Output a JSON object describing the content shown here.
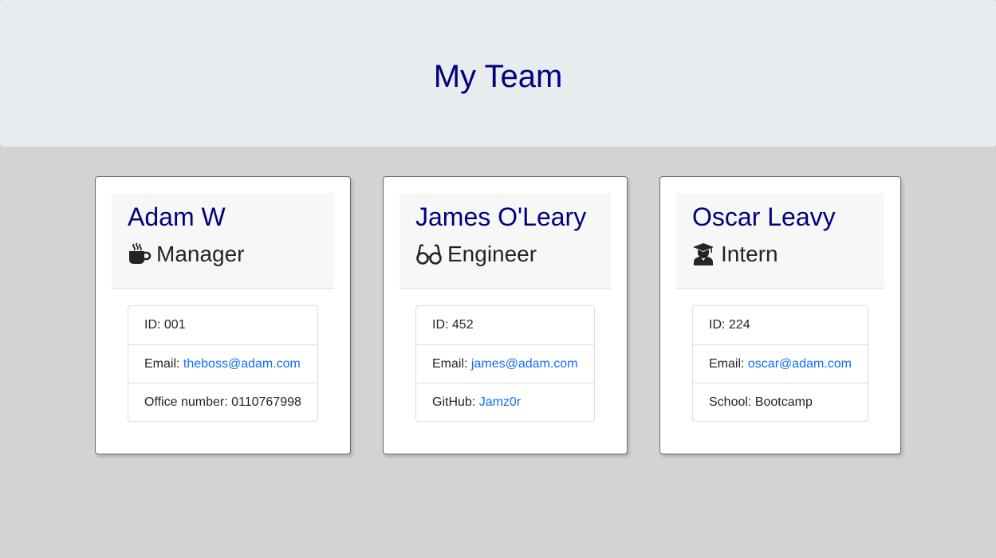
{
  "header": {
    "title": "My Team"
  },
  "colors": {
    "title": "#00007d",
    "link": "#0d6efd",
    "background": "#d3d3d3"
  },
  "members": [
    {
      "name": "Adam W",
      "role": "Manager",
      "role_icon": "coffee-icon",
      "id_label": "ID:",
      "id": "001",
      "email_label": "Email:",
      "email": "theboss@adam.com",
      "extra_label": "Office number:",
      "extra": "0110767998"
    },
    {
      "name": "James O'Leary",
      "role": "Engineer",
      "role_icon": "glasses-icon",
      "id_label": "ID:",
      "id": "452",
      "email_label": "Email:",
      "email": "james@adam.com",
      "extra_label": "GitHub:",
      "extra": "Jamz0r"
    },
    {
      "name": "Oscar Leavy",
      "role": "Intern",
      "role_icon": "graduate-icon",
      "id_label": "ID:",
      "id": "224",
      "email_label": "Email:",
      "email": "oscar@adam.com",
      "extra_label": "School:",
      "extra": "Bootcamp"
    }
  ]
}
